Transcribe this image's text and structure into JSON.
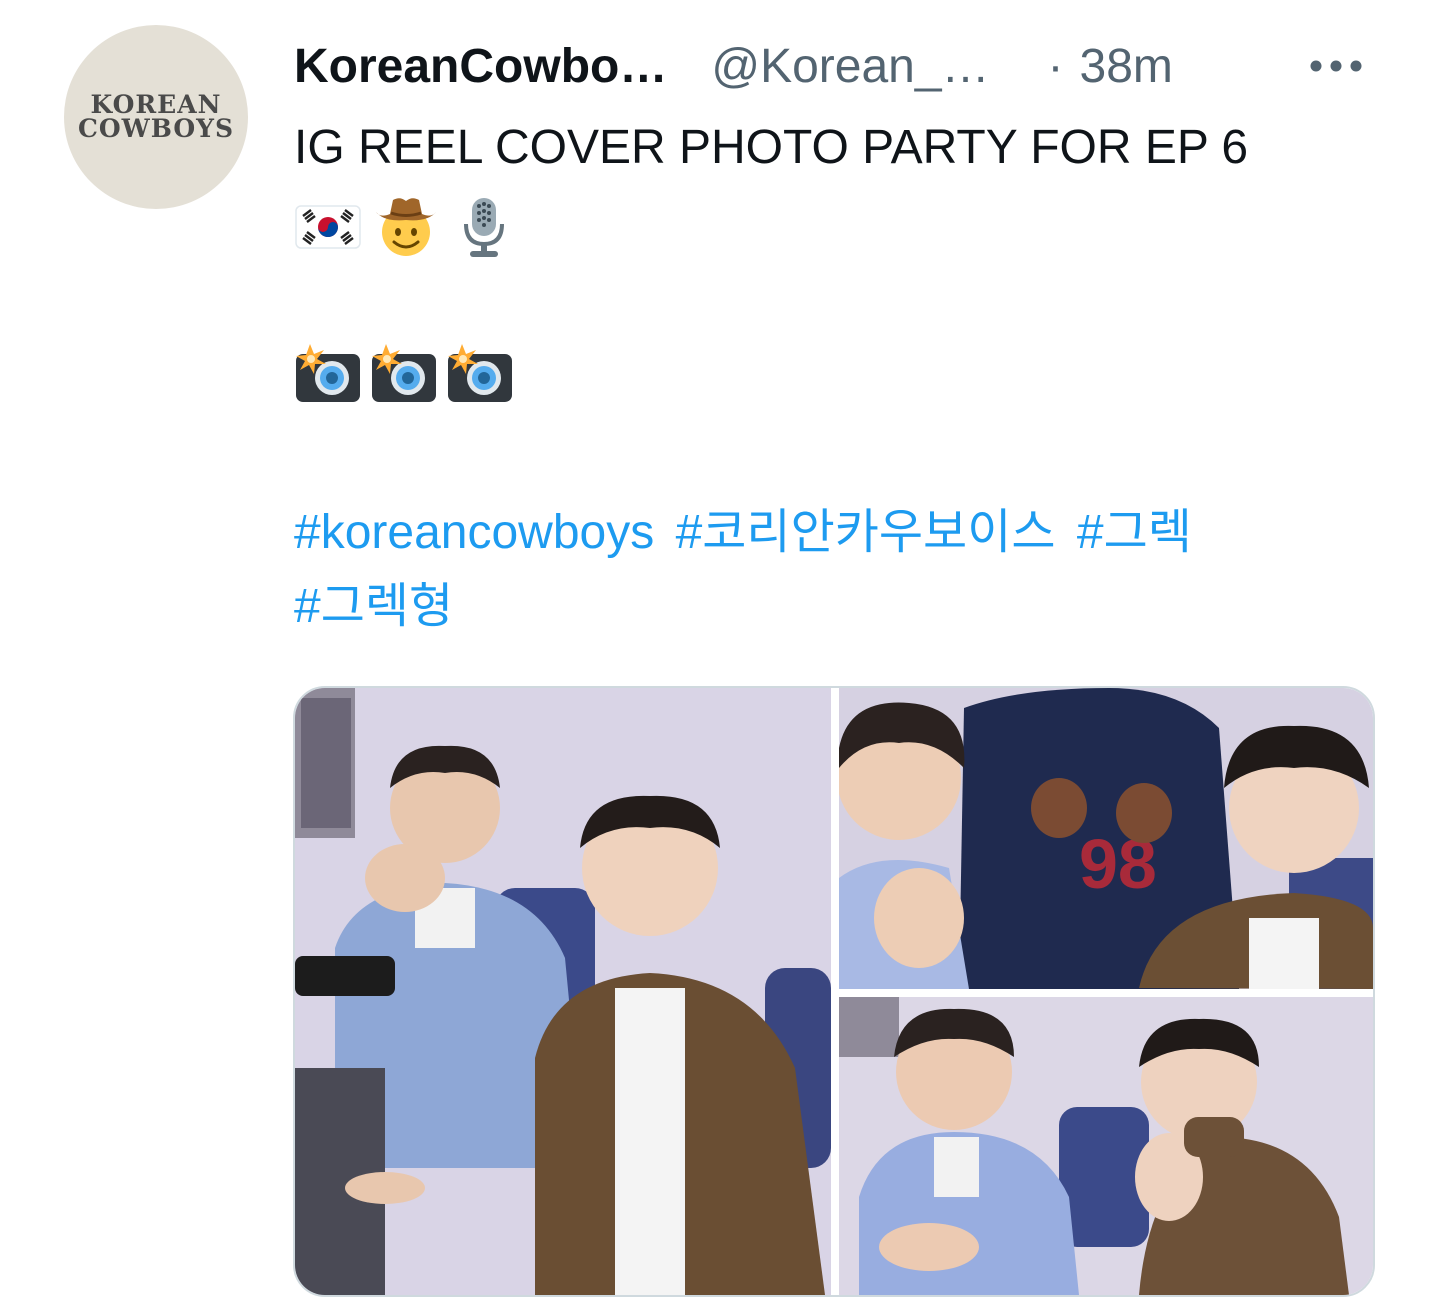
{
  "author": {
    "display_name": "KoreanCowbo…",
    "handle": "@Korean_…",
    "separator": "·",
    "time": "38m",
    "avatar_text_line1": "KOREAN",
    "avatar_text_line2": "COWBOYS"
  },
  "tweet": {
    "text_line1": "IG REEL COVER PHOTO PARTY FOR EP 6",
    "emoji_line1": [
      "korean-flag-emoji",
      "cowboy-face-emoji",
      "microphone-emoji"
    ],
    "emoji_line2": [
      "camera-flash-emoji",
      "camera-flash-emoji",
      "camera-flash-emoji"
    ],
    "hashtags": [
      "#koreancowboys",
      "#코리안카우보이스",
      "#그렉",
      "#그렉형"
    ]
  },
  "media": {
    "photo_count": 3,
    "photos": [
      {
        "name": "photo-1",
        "description_icon": "photo-icon"
      },
      {
        "name": "photo-2",
        "description_icon": "photo-icon"
      },
      {
        "name": "photo-3",
        "description_icon": "photo-icon"
      }
    ]
  },
  "colors": {
    "text": "#0f1419",
    "secondary": "#536471",
    "link": "#1d9bf0",
    "border": "#cfd9de"
  }
}
